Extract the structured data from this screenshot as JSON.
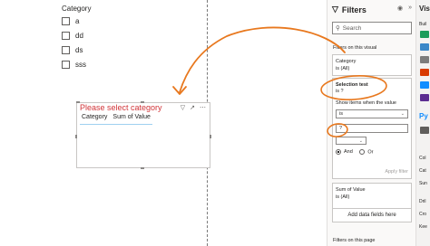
{
  "slicer": {
    "title": "Category",
    "items": [
      "a",
      "dd",
      "ds",
      "sss"
    ]
  },
  "visual": {
    "title": "Please select category",
    "headers": [
      "Category",
      "Sum of Value"
    ],
    "title_color": "#d13438"
  },
  "filters_pane": {
    "title": "Filters",
    "search_placeholder": "Search",
    "on_visual_label": "Filters on this visual",
    "category_card": {
      "field": "Category",
      "value": "is (All)"
    },
    "selection_card": {
      "field": "Selection test",
      "status": "is ?",
      "show_items_label": "Show items when the value",
      "condition": "is",
      "input_value": "?",
      "logic_and": "And",
      "logic_or": "Or",
      "apply_label": "Apply filter"
    },
    "sum_card": {
      "field": "Sum of Value",
      "value": "is (All)"
    },
    "add_fields_label": "Add data fields here",
    "on_page_label": "Filters on this page"
  },
  "viz_pane": {
    "title": "Visu",
    "build_label": "Buil",
    "py_label": "Py",
    "col_label": "Col",
    "cat_label": "Cat",
    "sum_label": "Sun",
    "dril_label": "Dril",
    "cro_label": "Cro",
    "kee_label": "Kee"
  },
  "colors": {
    "annotation_orange": "#e8781e",
    "accent_blue": "#118dff",
    "error_red": "#d13438"
  }
}
